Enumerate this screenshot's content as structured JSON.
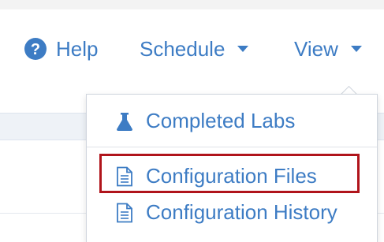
{
  "nav": {
    "help": {
      "label": "Help",
      "icon": "question-circle-icon"
    },
    "schedule": {
      "label": "Schedule",
      "icon": "caret-down-icon"
    },
    "view": {
      "label": "View",
      "icon": "caret-down-icon"
    }
  },
  "dropdown": {
    "items": [
      {
        "label": "Completed Labs",
        "icon": "flask-icon"
      },
      {
        "label": "Configuration Files",
        "icon": "document-icon"
      },
      {
        "label": "Configuration History",
        "icon": "document-icon"
      }
    ]
  },
  "colors": {
    "link": "#3d7cc4",
    "highlight_border": "#b0141b",
    "band": "#eef2f7"
  }
}
